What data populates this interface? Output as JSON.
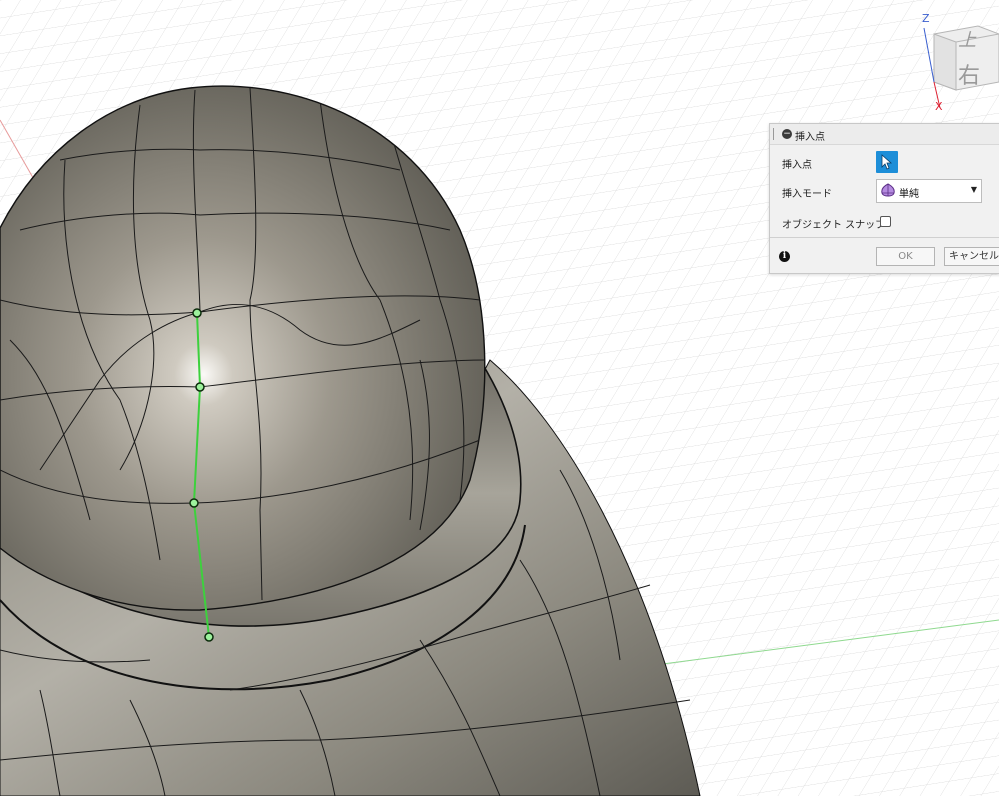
{
  "viewcube": {
    "axis_z": "Z",
    "axis_x": "X",
    "face_top": "上",
    "face_right": "右"
  },
  "dialog": {
    "title": "挿入点",
    "collapse_glyph": "−",
    "rows": {
      "insert_point_label": "挿入点",
      "insert_mode_label": "挿入モード",
      "insert_mode_value": "単純",
      "object_snap_label": "オブジェクト スナップ",
      "object_snap_checked": false
    },
    "info_glyph": "i",
    "ok_label": "OK",
    "cancel_label": "キャンセル"
  },
  "colors": {
    "select_button": "#1d8ed8",
    "selected_edge": "#3dd13d",
    "grid_line": "#d3d3d3",
    "axis_green": "#7bd07b",
    "axis_red": "#e08080"
  }
}
